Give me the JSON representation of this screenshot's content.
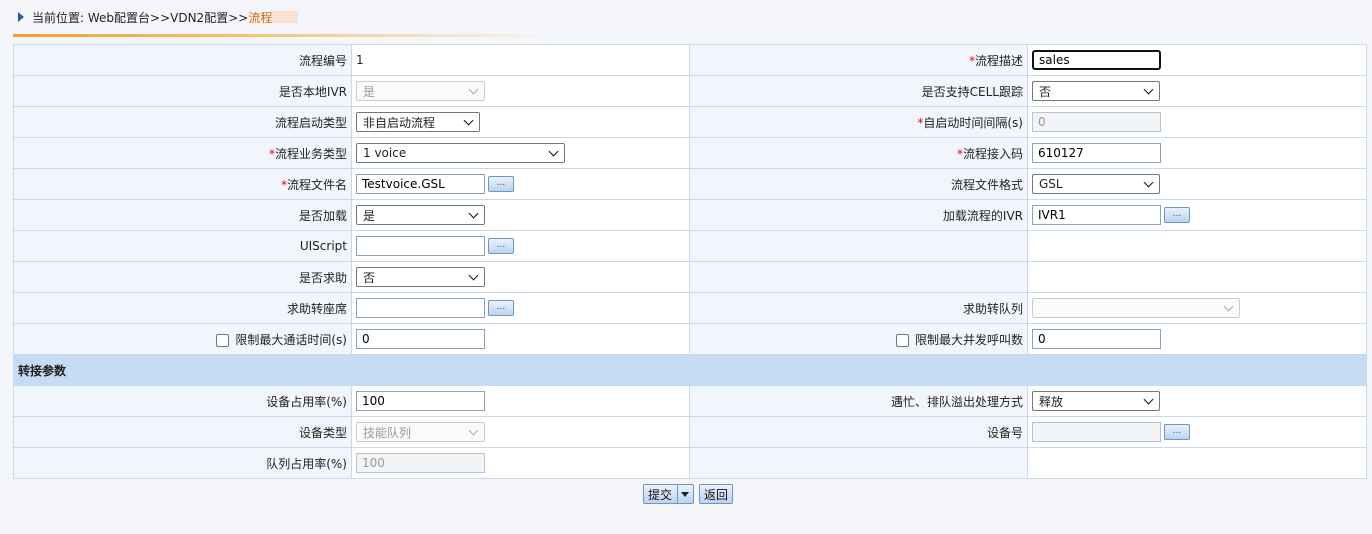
{
  "breadcrumb": {
    "prefix": "当前位置: Web配置台>>VDN2配置>>",
    "current": "流程"
  },
  "fields": {
    "flow_id": {
      "label": "流程编号",
      "value": "1"
    },
    "flow_desc": {
      "label": "流程描述",
      "value": "sales"
    },
    "local_ivr": {
      "label": "是否本地IVR",
      "value": "是"
    },
    "cell_trace": {
      "label": "是否支持CELL跟踪",
      "value": "否"
    },
    "start_type": {
      "label": "流程启动类型",
      "value": "非自启动流程"
    },
    "auto_interval": {
      "label": "自启动时间间隔(s)",
      "value": "0"
    },
    "biz_type": {
      "label": "流程业务类型",
      "value": "1 voice"
    },
    "access_code": {
      "label": "流程接入码",
      "value": "610127"
    },
    "file_name": {
      "label": "流程文件名",
      "value": "Testvoice.GSL"
    },
    "file_format": {
      "label": "流程文件格式",
      "value": "GSL"
    },
    "loaded": {
      "label": "是否加载",
      "value": "是"
    },
    "load_ivr": {
      "label": "加载流程的IVR",
      "value": "IVR1"
    },
    "uiscript": {
      "label": "UIScript",
      "value": ""
    },
    "help": {
      "label": "是否求助",
      "value": "否"
    },
    "help_agent": {
      "label": "求助转座席",
      "value": ""
    },
    "help_queue": {
      "label": "求助转队列",
      "value": ""
    },
    "max_talk": {
      "label": "限制最大通话时间(s)",
      "value": "0"
    },
    "max_calls": {
      "label": "限制最大并发呼叫数",
      "value": "0"
    }
  },
  "section_title": "转接参数",
  "transfer": {
    "device_rate": {
      "label": "设备占用率(%)",
      "value": "100"
    },
    "overflow": {
      "label": "遇忙、排队溢出处理方式",
      "value": "释放"
    },
    "device_type": {
      "label": "设备类型",
      "value": "技能队列"
    },
    "device_no": {
      "label": "设备号",
      "value": ""
    },
    "queue_rate": {
      "label": "队列占用率(%)",
      "value": "100"
    }
  },
  "required_mark": "*",
  "ellipsis": "...",
  "buttons": {
    "submit": "提交",
    "back": "返回"
  }
}
